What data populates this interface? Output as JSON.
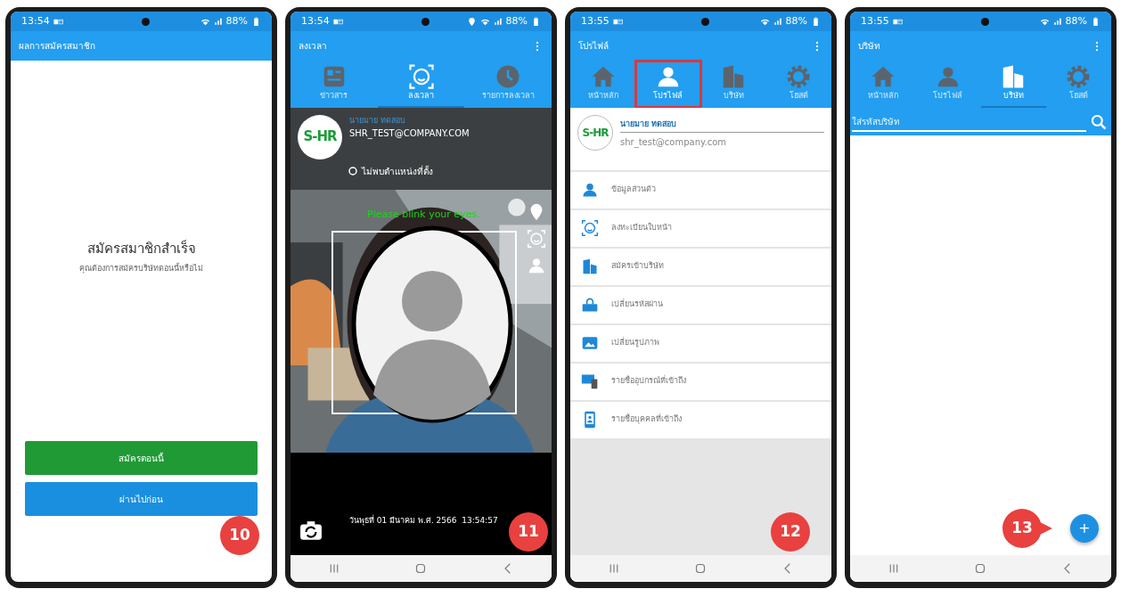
{
  "phones": [
    {
      "kind": "result",
      "status": {
        "time": "13:54",
        "battery": "88%",
        "location": false
      },
      "title": "ผลการสมัครสมาชิก",
      "menu": false,
      "heading": "สมัครสมาชิกสำเร็จ",
      "message": "คุณต้องการสมัครบริษัทตอนนี้หรือไม่",
      "buttons": [
        {
          "label": "สมัครตอนนี้",
          "kind": "primary"
        },
        {
          "label": "ผ่านไปก่อน",
          "kind": "secondary"
        }
      ],
      "step": "10"
    },
    {
      "kind": "checkin",
      "status": {
        "time": "13:54",
        "battery": "88%",
        "location": true
      },
      "title": "ลงเวลา",
      "menu": true,
      "tabs": [
        {
          "label": "ข่าวสาร",
          "selected": false,
          "highlighted": false
        },
        {
          "label": "ลงเวลา",
          "selected": true,
          "highlighted": false
        },
        {
          "label": "รายการลงเวลา",
          "selected": false,
          "highlighted": false
        }
      ],
      "user": {
        "logo_text": "S-HR",
        "name": "นายมาย ทดสอบ",
        "email": "SHR_TEST@COMPANY.COM"
      },
      "location_status": "ไม่พบตำแหน่งที่ตั้ง",
      "prompt": "Please blink your eyes.",
      "timestamp": "วันพุธที่ 01 มีนาคม พ.ศ. 2566  13:54:57",
      "step": "11"
    },
    {
      "kind": "profile",
      "status": {
        "time": "13:55",
        "battery": "88%",
        "location": false
      },
      "title": "โปรไฟล์",
      "menu": true,
      "tabs": [
        {
          "label": "หน้าหลัก",
          "selected": false,
          "highlighted": false
        },
        {
          "label": "โปรไฟล์",
          "selected": true,
          "highlighted": true
        },
        {
          "label": "บริษัท",
          "selected": false,
          "highlighted": false
        },
        {
          "label": "โฮสต์",
          "selected": false,
          "highlighted": false
        }
      ],
      "user": {
        "logo_text": "S-HR",
        "name": "นายมาย ทดสอบ",
        "email": "shr_test@company.com"
      },
      "menu_items": [
        {
          "label": "ข้อมูลส่วนตัว"
        },
        {
          "label": "ลงทะเบียนใบหน้า"
        },
        {
          "label": "สมัครเข้าบริษัท"
        },
        {
          "label": "เปลี่ยนรหัสผ่าน"
        },
        {
          "label": "เปลี่ยนรูปภาพ"
        },
        {
          "label": "รายชื่ออุปกรณ์ที่เข้าถึง"
        },
        {
          "label": "รายชื่อบุคคลที่เข้าถึง"
        }
      ],
      "step": "12"
    },
    {
      "kind": "company",
      "status": {
        "time": "13:55",
        "battery": "88%",
        "location": false
      },
      "title": "บริษัท",
      "menu": true,
      "tabs": [
        {
          "label": "หน้าหลัก",
          "selected": false,
          "highlighted": false
        },
        {
          "label": "โปรไฟล์",
          "selected": false,
          "highlighted": false
        },
        {
          "label": "บริษัท",
          "selected": true,
          "highlighted": false
        },
        {
          "label": "โฮสต์",
          "selected": false,
          "highlighted": false
        }
      ],
      "search": {
        "placeholder": "ใส่รหัสบริษัท"
      },
      "fab": "+",
      "step": "13"
    }
  ]
}
